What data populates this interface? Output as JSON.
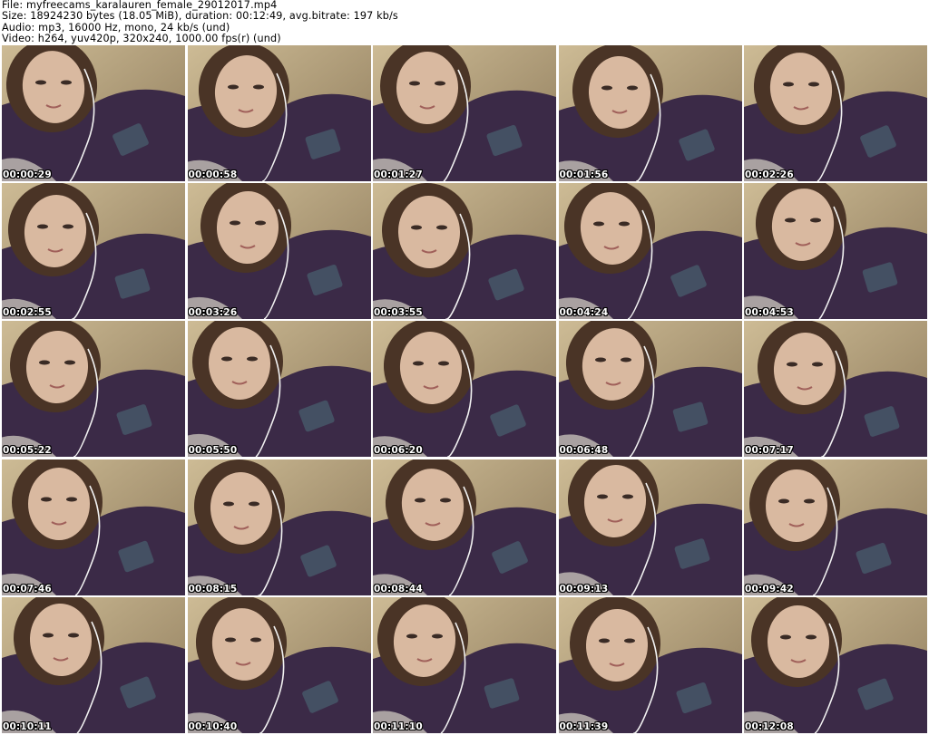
{
  "header": {
    "file_line": "File: myfreecams_karalauren_female_29012017.mp4",
    "size_line": "Size: 18924230 bytes (18.05 MiB), duration: 00:12:49, avg.bitrate: 197 kb/s",
    "audio_line": "Audio: mp3, 16000 Hz, mono, 24 kb/s (und)",
    "video_line": "Video: h264, yuv420p, 320x240, 1000.00 fps(r) (und)"
  },
  "thumbnails": [
    {
      "timestamp": "00:00:29"
    },
    {
      "timestamp": "00:00:58"
    },
    {
      "timestamp": "00:01:27"
    },
    {
      "timestamp": "00:01:56"
    },
    {
      "timestamp": "00:02:26"
    },
    {
      "timestamp": "00:02:55"
    },
    {
      "timestamp": "00:03:26"
    },
    {
      "timestamp": "00:03:55"
    },
    {
      "timestamp": "00:04:24"
    },
    {
      "timestamp": "00:04:53"
    },
    {
      "timestamp": "00:05:22"
    },
    {
      "timestamp": "00:05:50"
    },
    {
      "timestamp": "00:06:20"
    },
    {
      "timestamp": "00:06:48"
    },
    {
      "timestamp": "00:07:17"
    },
    {
      "timestamp": "00:07:46"
    },
    {
      "timestamp": "00:08:15"
    },
    {
      "timestamp": "00:08:44"
    },
    {
      "timestamp": "00:09:13"
    },
    {
      "timestamp": "00:09:42"
    },
    {
      "timestamp": "00:10:11"
    },
    {
      "timestamp": "00:10:40"
    },
    {
      "timestamp": "00:11:10"
    },
    {
      "timestamp": "00:11:39"
    },
    {
      "timestamp": "00:12:08"
    }
  ],
  "colors": {
    "background": "#ffffff",
    "header_text": "#000000",
    "stamp_text": "#ffffff",
    "stamp_outline": "#000000",
    "sweater": "#3b2a47",
    "wall": "#b8a582",
    "skin": "#d9b9a0",
    "hair": "#4a3426"
  }
}
